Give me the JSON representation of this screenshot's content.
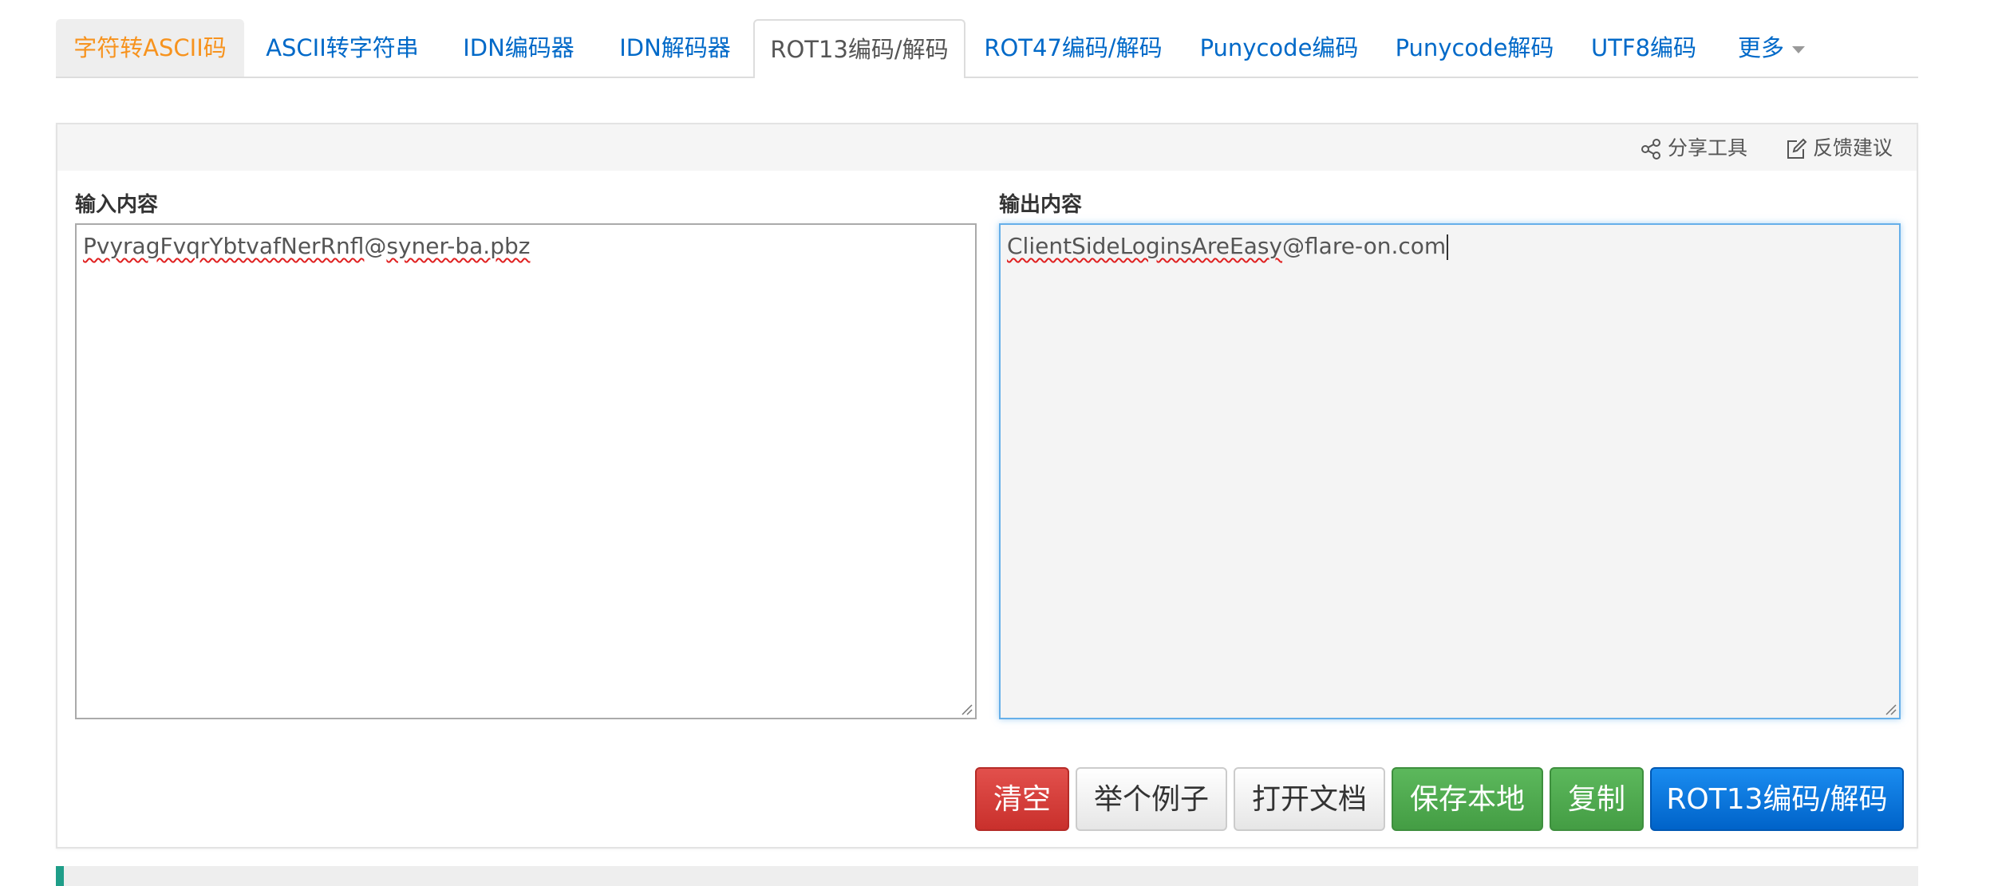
{
  "colors": {
    "link": "#0069c8",
    "first_tab_text": "#f7931e",
    "clear_button": "#d9534f",
    "success_button": "#5cb85c",
    "primary_button": "#0a74e0",
    "bottom_accent": "#1f9e89"
  },
  "tabs": [
    {
      "label": "字符转ASCII码"
    },
    {
      "label": "ASCII转字符串"
    },
    {
      "label": "IDN编码器"
    },
    {
      "label": "IDN解码器"
    },
    {
      "label": "ROT13编码/解码",
      "active": true
    },
    {
      "label": "ROT47编码/解码"
    },
    {
      "label": "Punycode编码"
    },
    {
      "label": "Punycode解码"
    },
    {
      "label": "UTF8编码"
    },
    {
      "label": "更多",
      "icon": "caret-down-icon"
    }
  ],
  "toolbar": {
    "share_label": "分享工具",
    "share_icon": "share-icon",
    "feedback_label": "反馈建议",
    "feedback_icon": "edit-icon"
  },
  "input": {
    "label": "输入内容",
    "value_word": "PvyragFvqrYbtvafNerRnfl",
    "value_at": "@",
    "value_domain": "syner-ba.pbz"
  },
  "output": {
    "label": "输出内容",
    "value_word": "ClientSideLoginsAreEasy",
    "value_rest": "@flare-on.com"
  },
  "buttons": {
    "clear": "清空",
    "example": "举个例子",
    "open_file": "打开文档",
    "save_local": "保存本地",
    "copy": "复制",
    "run": "ROT13编码/解码"
  }
}
